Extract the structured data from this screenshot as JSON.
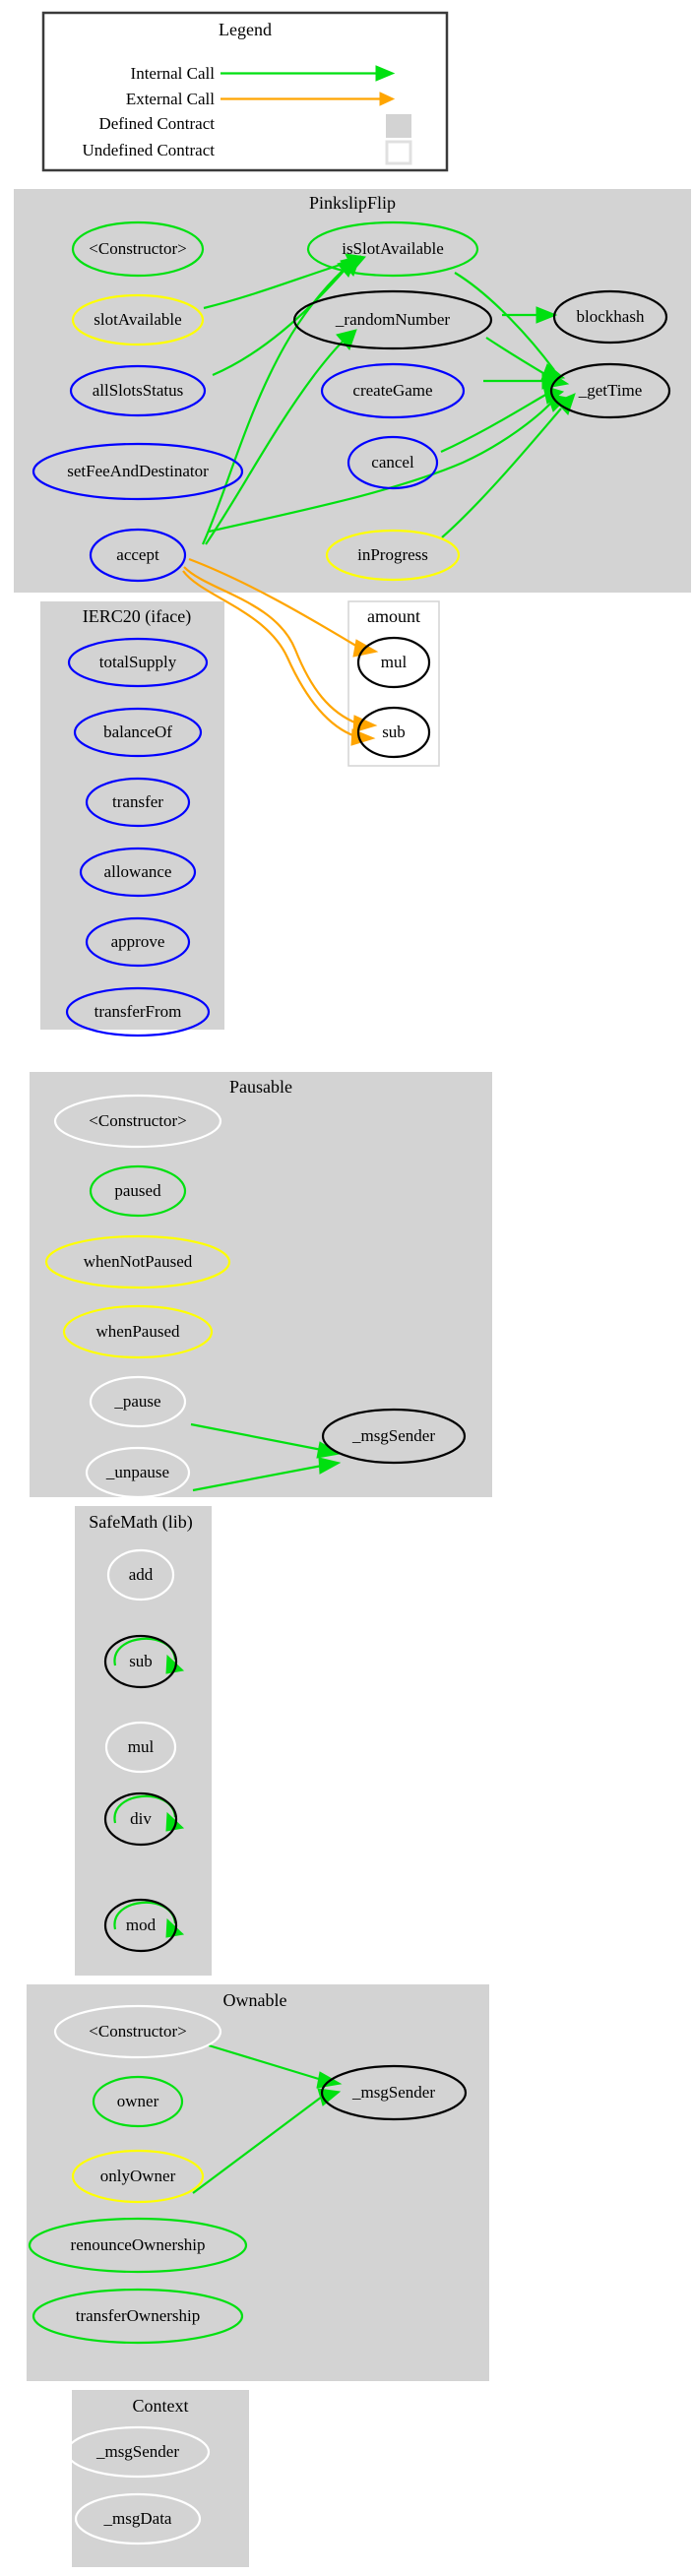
{
  "legend": {
    "title": "Legend",
    "rows": [
      {
        "label": "Internal Call",
        "kind": "edge",
        "color": "#00e010"
      },
      {
        "label": "External Call",
        "kind": "edge",
        "color": "#ffa500"
      },
      {
        "label": "Defined Contract",
        "kind": "swatch",
        "color": "#d3d3d3"
      },
      {
        "label": "Undefined Contract",
        "kind": "swatch",
        "color": "#ffffff"
      }
    ]
  },
  "colors": {
    "internal_call": "#00e010",
    "external_call": "#ffa500",
    "cluster_fill": "#d3d3d3",
    "public": "#0000ff",
    "internal_fn": "#00e010",
    "modifier": "#ffff00",
    "private": "#ffffff",
    "undefined_fn": "#000000"
  },
  "chart_data": {
    "type": "diagram",
    "title": "Solidity contract call graph",
    "clusters": [
      {
        "id": "pinkslipflip",
        "label": "PinkslipFlip",
        "style": "defined",
        "nodes": [
          {
            "id": "psf_ctor",
            "label": "<Constructor>",
            "color": "#00e010"
          },
          {
            "id": "psf_isSlotAvailable",
            "label": "isSlotAvailable",
            "color": "#00e010"
          },
          {
            "id": "psf_slotAvailable",
            "label": "slotAvailable",
            "color": "#ffff00"
          },
          {
            "id": "psf_randomNumber",
            "label": "_randomNumber",
            "color": "#000000"
          },
          {
            "id": "psf_blockhash",
            "label": "blockhash",
            "color": "#000000"
          },
          {
            "id": "psf_allSlotsStatus",
            "label": "allSlotsStatus",
            "color": "#0000ff"
          },
          {
            "id": "psf_createGame",
            "label": "createGame",
            "color": "#0000ff"
          },
          {
            "id": "psf_getTime",
            "label": "_getTime",
            "color": "#000000"
          },
          {
            "id": "psf_cancel",
            "label": "cancel",
            "color": "#0000ff"
          },
          {
            "id": "psf_setFee",
            "label": "setFeeAndDestinator",
            "color": "#0000ff"
          },
          {
            "id": "psf_accept",
            "label": "accept",
            "color": "#0000ff"
          },
          {
            "id": "psf_inProgress",
            "label": "inProgress",
            "color": "#ffff00"
          }
        ]
      },
      {
        "id": "ierc20",
        "label": "IERC20  (iface)",
        "style": "defined",
        "nodes": [
          {
            "id": "erc_totalSupply",
            "label": "totalSupply",
            "color": "#0000ff"
          },
          {
            "id": "erc_balanceOf",
            "label": "balanceOf",
            "color": "#0000ff"
          },
          {
            "id": "erc_transfer",
            "label": "transfer",
            "color": "#0000ff"
          },
          {
            "id": "erc_allowance",
            "label": "allowance",
            "color": "#0000ff"
          },
          {
            "id": "erc_approve",
            "label": "approve",
            "color": "#0000ff"
          },
          {
            "id": "erc_transferFrom",
            "label": "transferFrom",
            "color": "#0000ff"
          }
        ]
      },
      {
        "id": "amount",
        "label": "amount",
        "style": "undefined",
        "nodes": [
          {
            "id": "amt_mul",
            "label": "mul",
            "color": "#000000"
          },
          {
            "id": "amt_sub",
            "label": "sub",
            "color": "#000000"
          }
        ]
      },
      {
        "id": "pausable",
        "label": "Pausable",
        "style": "defined",
        "nodes": [
          {
            "id": "pa_ctor",
            "label": "<Constructor>",
            "color": "#ffffff"
          },
          {
            "id": "pa_paused",
            "label": "paused",
            "color": "#00e010"
          },
          {
            "id": "pa_whenNotPaused",
            "label": "whenNotPaused",
            "color": "#ffff00"
          },
          {
            "id": "pa_whenPaused",
            "label": "whenPaused",
            "color": "#ffff00"
          },
          {
            "id": "pa_pause",
            "label": "_pause",
            "color": "#ffffff"
          },
          {
            "id": "pa_unpause",
            "label": "_unpause",
            "color": "#ffffff"
          },
          {
            "id": "pa_msgSender",
            "label": "_msgSender",
            "color": "#000000"
          }
        ]
      },
      {
        "id": "safemath",
        "label": "SafeMath  (lib)",
        "style": "defined",
        "nodes": [
          {
            "id": "sm_add",
            "label": "add",
            "color": "#ffffff"
          },
          {
            "id": "sm_sub",
            "label": "sub",
            "color": "#000000"
          },
          {
            "id": "sm_mul",
            "label": "mul",
            "color": "#ffffff"
          },
          {
            "id": "sm_div",
            "label": "div",
            "color": "#000000"
          },
          {
            "id": "sm_mod",
            "label": "mod",
            "color": "#000000"
          }
        ]
      },
      {
        "id": "ownable",
        "label": "Ownable",
        "style": "defined",
        "nodes": [
          {
            "id": "ow_ctor",
            "label": "<Constructor>",
            "color": "#ffffff"
          },
          {
            "id": "ow_owner",
            "label": "owner",
            "color": "#00e010"
          },
          {
            "id": "ow_onlyOwner",
            "label": "onlyOwner",
            "color": "#ffff00"
          },
          {
            "id": "ow_renounce",
            "label": "renounceOwnership",
            "color": "#00e010"
          },
          {
            "id": "ow_transfer",
            "label": "transferOwnership",
            "color": "#00e010"
          },
          {
            "id": "ow_msgSender",
            "label": "_msgSender",
            "color": "#000000"
          }
        ]
      },
      {
        "id": "context",
        "label": "Context",
        "style": "defined",
        "nodes": [
          {
            "id": "ctx_msgSender",
            "label": "_msgSender",
            "color": "#ffffff"
          },
          {
            "id": "ctx_msgData",
            "label": "_msgData",
            "color": "#ffffff"
          }
        ]
      }
    ],
    "edges": [
      {
        "from": "psf_slotAvailable",
        "to": "psf_isSlotAvailable",
        "type": "internal"
      },
      {
        "from": "psf_allSlotsStatus",
        "to": "psf_isSlotAvailable",
        "type": "internal"
      },
      {
        "from": "psf_accept",
        "to": "psf_isSlotAvailable",
        "type": "internal"
      },
      {
        "from": "psf_accept",
        "to": "psf_randomNumber",
        "type": "internal"
      },
      {
        "from": "psf_randomNumber",
        "to": "psf_blockhash",
        "type": "internal"
      },
      {
        "from": "psf_randomNumber",
        "to": "psf_getTime",
        "type": "internal"
      },
      {
        "from": "psf_isSlotAvailable",
        "to": "psf_getTime",
        "type": "internal"
      },
      {
        "from": "psf_createGame",
        "to": "psf_getTime",
        "type": "internal"
      },
      {
        "from": "psf_cancel",
        "to": "psf_getTime",
        "type": "internal"
      },
      {
        "from": "psf_accept",
        "to": "psf_getTime",
        "type": "internal"
      },
      {
        "from": "psf_inProgress",
        "to": "psf_getTime",
        "type": "internal"
      },
      {
        "from": "psf_accept",
        "to": "amt_mul",
        "type": "external"
      },
      {
        "from": "psf_accept",
        "to": "amt_sub",
        "type": "external"
      },
      {
        "from": "psf_accept",
        "to": "amt_sub",
        "type": "external"
      },
      {
        "from": "pa_pause",
        "to": "pa_msgSender",
        "type": "internal"
      },
      {
        "from": "pa_unpause",
        "to": "pa_msgSender",
        "type": "internal"
      },
      {
        "from": "sm_sub",
        "to": "sm_sub",
        "type": "internal"
      },
      {
        "from": "sm_div",
        "to": "sm_div",
        "type": "internal"
      },
      {
        "from": "sm_mod",
        "to": "sm_mod",
        "type": "internal"
      },
      {
        "from": "ow_ctor",
        "to": "ow_msgSender",
        "type": "internal"
      },
      {
        "from": "ow_onlyOwner",
        "to": "ow_msgSender",
        "type": "internal"
      }
    ]
  }
}
